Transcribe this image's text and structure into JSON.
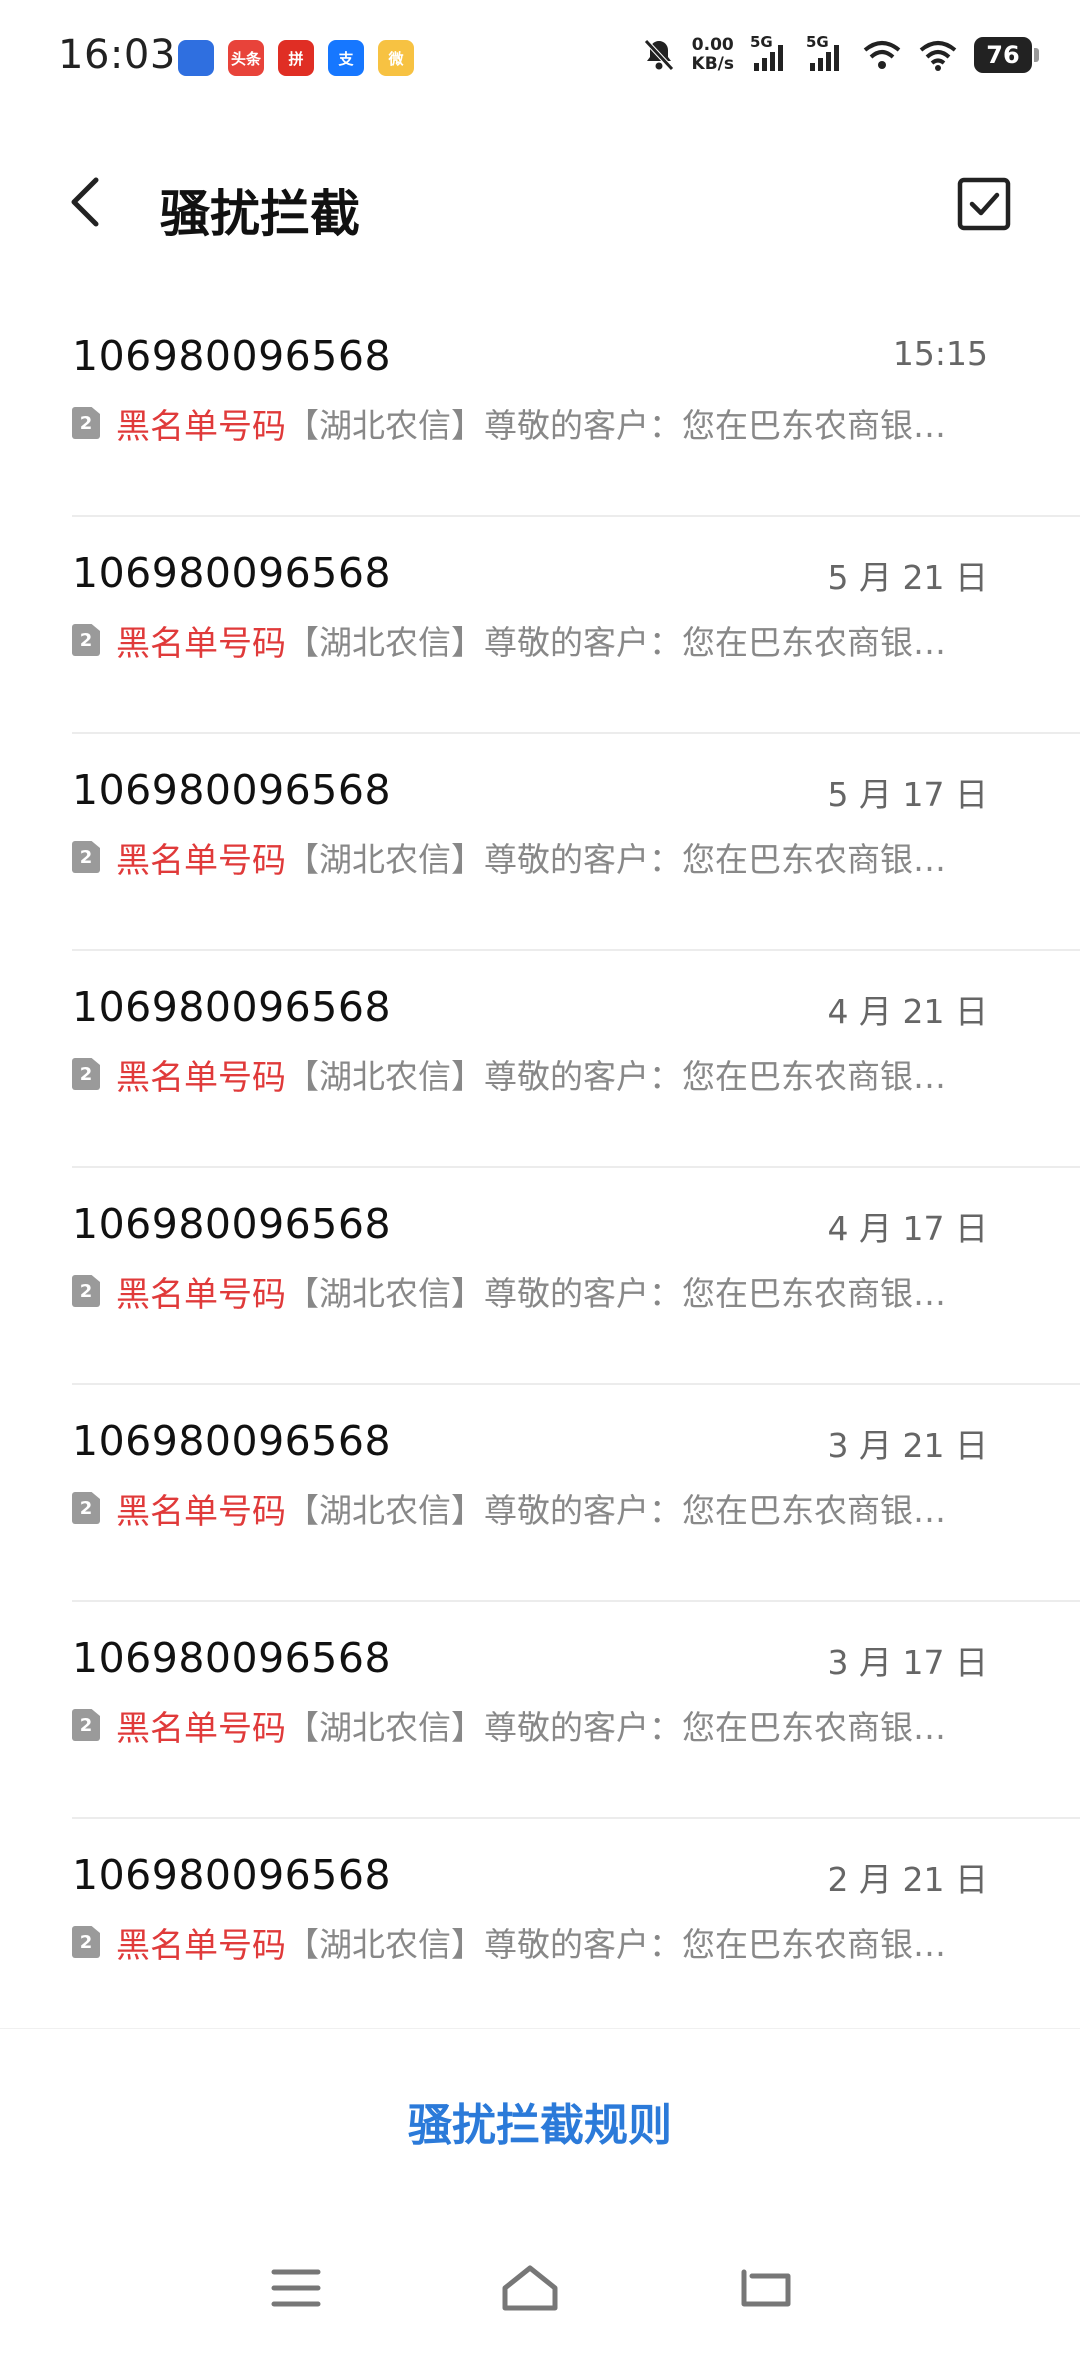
{
  "status_bar": {
    "time": "16:03",
    "net_speed_value": "0.00",
    "net_speed_unit": "KB/s",
    "signal1_label": "5G",
    "signal2_label": "5G",
    "battery": "76",
    "app_icons": [
      {
        "name": "message-app-icon",
        "label": "",
        "color": "#2f6fe0"
      },
      {
        "name": "toutiao-icon",
        "label": "头条",
        "color": "#e8433a"
      },
      {
        "name": "pinduoduo-icon",
        "label": "拼",
        "color": "#e02e24"
      },
      {
        "name": "alipay-icon",
        "label": "支",
        "color": "#1677ff"
      },
      {
        "name": "weibo-icon",
        "label": "微",
        "color": "#f7c242"
      }
    ]
  },
  "header": {
    "title": "骚扰拦截"
  },
  "messages": [
    {
      "sender": "106980096568",
      "date": "15:15",
      "sim": "2",
      "tag": "黑名单号码",
      "preview": "【湖北农信】尊敬的客户：您在巴东农商银…"
    },
    {
      "sender": "106980096568",
      "date": "5 月 21 日",
      "sim": "2",
      "tag": "黑名单号码",
      "preview": "【湖北农信】尊敬的客户：您在巴东农商银…"
    },
    {
      "sender": "106980096568",
      "date": "5 月 17 日",
      "sim": "2",
      "tag": "黑名单号码",
      "preview": "【湖北农信】尊敬的客户：您在巴东农商银…"
    },
    {
      "sender": "106980096568",
      "date": "4 月 21 日",
      "sim": "2",
      "tag": "黑名单号码",
      "preview": "【湖北农信】尊敬的客户：您在巴东农商银…"
    },
    {
      "sender": "106980096568",
      "date": "4 月 17 日",
      "sim": "2",
      "tag": "黑名单号码",
      "preview": "【湖北农信】尊敬的客户：您在巴东农商银…"
    },
    {
      "sender": "106980096568",
      "date": "3 月 21 日",
      "sim": "2",
      "tag": "黑名单号码",
      "preview": "【湖北农信】尊敬的客户：您在巴东农商银…"
    },
    {
      "sender": "106980096568",
      "date": "3 月 17 日",
      "sim": "2",
      "tag": "黑名单号码",
      "preview": "【湖北农信】尊敬的客户：您在巴东农商银…"
    },
    {
      "sender": "106980096568",
      "date": "2 月 21 日",
      "sim": "2",
      "tag": "黑名单号码",
      "preview": "【湖北农信】尊敬的客户：您在巴东农商银…"
    }
  ],
  "footer": {
    "rules_label": "骚扰拦截规则"
  },
  "colors": {
    "accent": "#2b7ad9",
    "blacklist_tag": "#e03a3a"
  }
}
